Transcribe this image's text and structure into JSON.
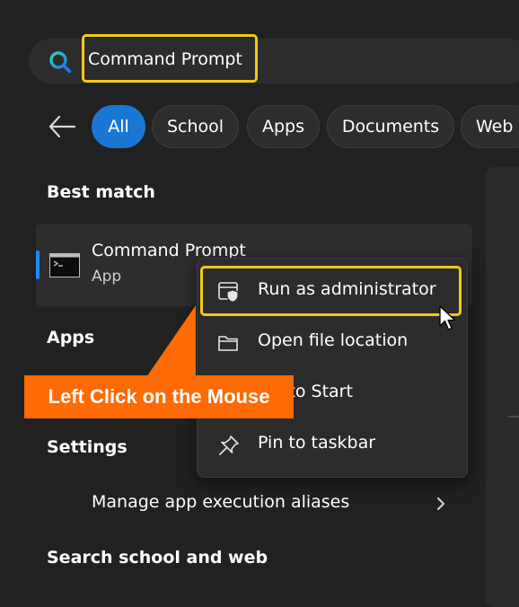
{
  "search": {
    "value": "Command Prompt",
    "highlight_color": "#f2c81a"
  },
  "filters": {
    "back_icon": "arrow-left-icon",
    "items": [
      {
        "label": "All",
        "active": true
      },
      {
        "label": "School",
        "active": false
      },
      {
        "label": "Apps",
        "active": false
      },
      {
        "label": "Documents",
        "active": false
      },
      {
        "label": "Web",
        "active": false
      }
    ],
    "active_color": "#1a78d4"
  },
  "sections": {
    "best_match": "Best match",
    "apps": "Apps",
    "settings": "Settings",
    "search_school_web": "Search school and web"
  },
  "best_match": {
    "title": "Command Prompt",
    "subtitle": "App",
    "icon": "command-prompt-icon",
    "accent_color": "#1a8cff"
  },
  "settings_item": {
    "label": "Manage app execution aliases",
    "icon": "chevron-right-icon"
  },
  "context_menu": {
    "items": [
      {
        "label": "Run as administrator",
        "icon": "shield-icon",
        "highlighted": true
      },
      {
        "label": "Open file location",
        "icon": "folder-icon",
        "highlighted": false
      },
      {
        "label": "Pin to Start",
        "icon": "pin-icon",
        "highlighted": false
      },
      {
        "label": "Pin to taskbar",
        "icon": "pin-icon",
        "highlighted": false
      }
    ]
  },
  "callout": {
    "text": "Left Click on the Mouse",
    "color": "#fe6a03"
  },
  "colors": {
    "background": "#212121",
    "panel": "#2d2d2d",
    "menu": "#2c2c2c",
    "text": "#ffffff"
  }
}
